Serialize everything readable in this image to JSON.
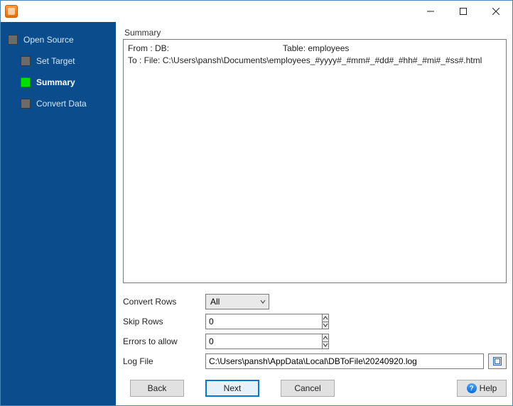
{
  "sidebar": {
    "items": [
      {
        "label": "Open Source"
      },
      {
        "label": "Set Target"
      },
      {
        "label": "Summary"
      },
      {
        "label": "Convert Data"
      }
    ]
  },
  "main": {
    "section_title": "Summary",
    "summary": {
      "from_prefix": "From : DB:",
      "table_prefix": "Table: ",
      "table_name": "employees",
      "to_prefix": "To : File: ",
      "to_path": "C:\\Users\\pansh\\Documents\\employees_#yyyy#_#mm#_#dd#_#hh#_#mi#_#ss#.html"
    },
    "form": {
      "convert_rows_label": "Convert Rows",
      "convert_rows_value": "All",
      "skip_rows_label": "Skip Rows",
      "skip_rows_value": "0",
      "errors_label": "Errors to allow",
      "errors_value": "0",
      "log_file_label": "Log File",
      "log_file_value": "C:\\Users\\pansh\\AppData\\Local\\DBToFile\\20240920.log"
    },
    "buttons": {
      "back": "Back",
      "next": "Next",
      "cancel": "Cancel",
      "help": "Help"
    }
  }
}
